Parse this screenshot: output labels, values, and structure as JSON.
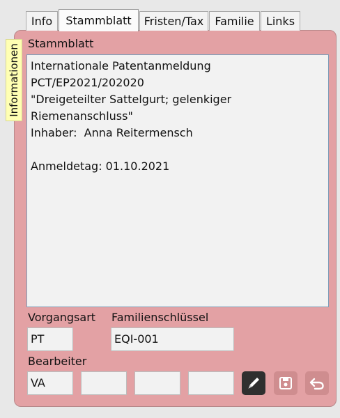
{
  "tabs": [
    "Info",
    "Stammblatt",
    "Fristen/Tax",
    "Familie",
    "Links"
  ],
  "side_tab": "Informationen",
  "section_title": "Stammblatt",
  "memo_text": "Internationale Patentanmeldung PCT/EP2021/202020\n\"Dreigeteilter Sattelgurt; gelenkiger Riemenanschluss\"\nInhaber:  Anna Reitermensch\n\nAnmeldetag: 01.10.2021",
  "fields": {
    "vorgangsart_label": "Vorgangsart",
    "vorgangsart_value": "PT",
    "familienschluessel_label": "Familienschlüssel",
    "familienschluessel_value": "EQI-001",
    "bearbeiter_label": "Bearbeiter",
    "bearbeiter_values": [
      "VA",
      "",
      "",
      ""
    ]
  },
  "buttons": {
    "edit": "pen-icon",
    "save": "floppy-disk-icon",
    "undo": "undo-arrow-icon"
  },
  "colors": {
    "panel": "#e3a1a4",
    "side_tab": "#ffffb3",
    "edit_button": "#2f2f2f",
    "disabled_button": "#cf8d8f"
  }
}
